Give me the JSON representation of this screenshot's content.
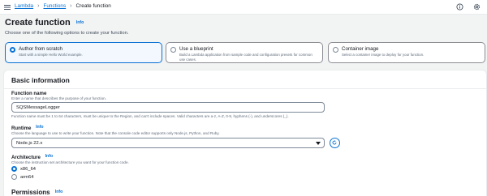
{
  "breadcrumb": {
    "service": "Lambda",
    "section": "Functions",
    "current": "Create function"
  },
  "page": {
    "title": "Create function",
    "info": "Info",
    "subtitle": "Choose one of the following options to create your function."
  },
  "options": [
    {
      "title": "Author from scratch",
      "desc": "Start with a simple Hello World example.",
      "selected": true
    },
    {
      "title": "Use a blueprint",
      "desc": "Build a Lambda application from sample code and configuration presets for common use cases.",
      "selected": false
    },
    {
      "title": "Container image",
      "desc": "Select a container image to deploy for your function.",
      "selected": false
    }
  ],
  "basic": {
    "heading": "Basic information",
    "name_label": "Function name",
    "name_desc": "Enter a name that describes the purpose of your function.",
    "name_value": "SQSMessageLogger",
    "name_hint": "Function name must be 1 to 64 characters, must be unique to the Region, and can't include spaces. Valid characters are a-z, A-Z, 0-9, hyphens (-), and underscores (_).",
    "runtime_label": "Runtime",
    "runtime_info": "Info",
    "runtime_desc": "Choose the language to use to write your function. Note that the console code editor supports only Node.js, Python, and Ruby.",
    "runtime_value": "Node.js 22.x",
    "arch_label": "Architecture",
    "arch_info": "Info",
    "arch_desc": "Choose the instruction set architecture you want for your function code.",
    "arch_options": [
      "x86_64",
      "arm64"
    ],
    "permissions_label": "Permissions",
    "permissions_info": "Info"
  },
  "colors": {
    "accent": "#0972d3",
    "text": "#16191f",
    "muted": "#5f6b7a",
    "background": "#f2f3f3"
  }
}
